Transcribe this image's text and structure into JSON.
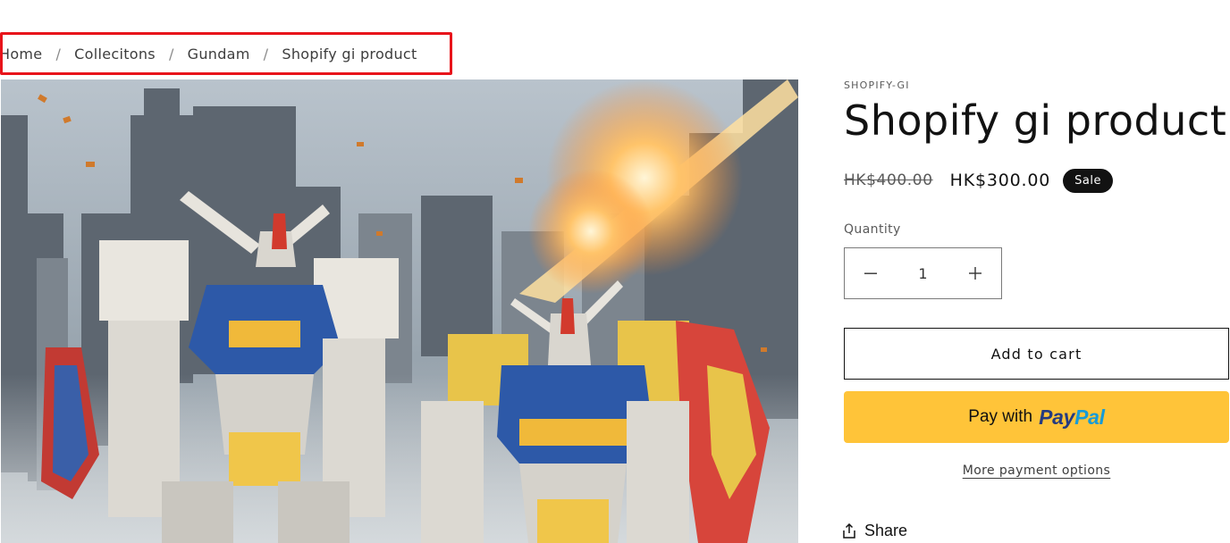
{
  "breadcrumb": {
    "items": [
      "Home",
      "Collecitons",
      "Gundam",
      "Shopify gi product"
    ],
    "separator": "/"
  },
  "product": {
    "image_alt": "Two Gundam mecha robots standing in a ruined city with explosions",
    "vendor": "SHOPIFY-GI",
    "title": "Shopify gi product",
    "compare_price": "HK$400.00",
    "sale_price": "HK$300.00",
    "sale_badge": "Sale"
  },
  "quantity": {
    "label": "Quantity",
    "value": "1",
    "decrease_icon": "minus-icon",
    "increase_icon": "plus-icon"
  },
  "actions": {
    "add_to_cart": "Add to cart",
    "paypal_prefix": "Pay with",
    "paypal_brand_1": "Pay",
    "paypal_brand_2": "Pal",
    "more_payment_options": "More payment options",
    "share": "Share",
    "share_icon": "share-icon"
  },
  "colors": {
    "highlight_border": "#e8141b",
    "paypal_yellow": "#ffc439",
    "paypal_dark_blue": "#253b80",
    "paypal_light_blue": "#179bd7",
    "badge_bg": "#121212"
  }
}
